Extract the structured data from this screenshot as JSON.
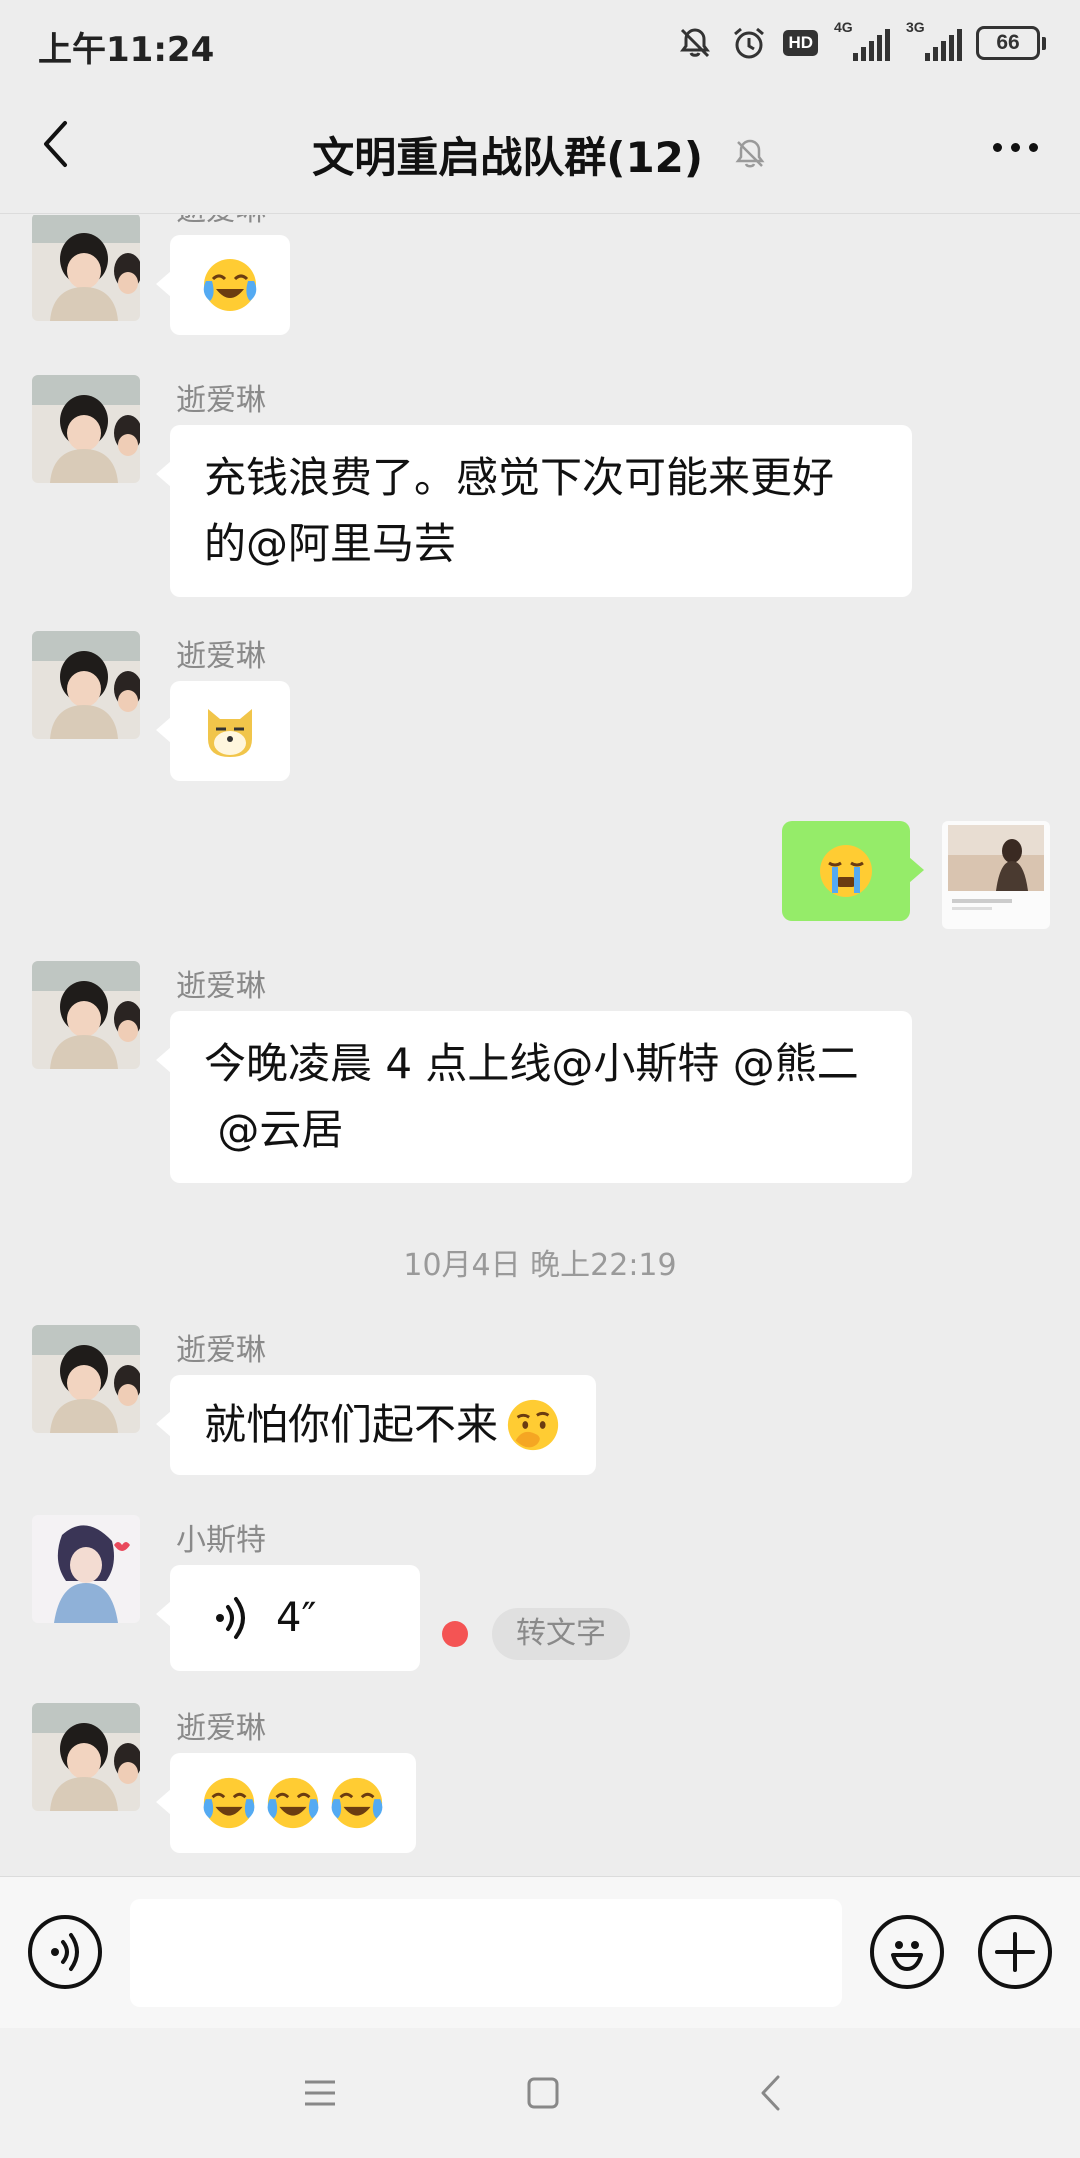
{
  "status_bar": {
    "time": "上午11:24",
    "hd": "HD",
    "signal1": "4G",
    "signal2": "3G",
    "battery": "66"
  },
  "header": {
    "title": "文明重启战队群(12)"
  },
  "messages": [
    {
      "sender": "逝爱琳",
      "text": ""
    },
    {
      "sender": "逝爱琳",
      "text": "充钱浪费了。感觉下次可能来更好的@阿里马芸"
    },
    {
      "sender": "逝爱琳",
      "text": ""
    },
    {
      "sender": "me",
      "text": ""
    },
    {
      "sender": "逝爱琳",
      "text": "今晚凌晨 4 点上线@小斯特 @熊二 @云居"
    },
    {
      "sender": "逝爱琳",
      "text": "就怕你们起不来"
    },
    {
      "sender": "小斯特",
      "voice_duration": "4″",
      "convert_label": "转文字"
    },
    {
      "sender": "逝爱琳",
      "text": ""
    }
  ],
  "time_separator": "10月4日 晚上22:19",
  "message_texts": {
    "m2_line1": "充钱浪费了。感觉下次可能来更好",
    "m2_line2": "的@阿里马芸",
    "m5_line1": "今晚凌晨 4 点上线@小斯特 @熊二",
    "m5_line2": " @云居"
  },
  "emojis": {
    "m1": [
      "crying-laughing-emoji"
    ],
    "m3": [
      "doge-emoji"
    ],
    "m4": [
      "crying-emoji"
    ],
    "m6": [
      "thinking-emoji"
    ],
    "m8": [
      "crying-laughing-emoji",
      "crying-laughing-emoji",
      "crying-laughing-emoji"
    ]
  },
  "input": {
    "value": "",
    "placeholder": ""
  },
  "colors": {
    "background": "#ededed",
    "my_bubble": "#95ec69",
    "their_bubble": "#ffffff",
    "unread_dot": "#f45454"
  }
}
